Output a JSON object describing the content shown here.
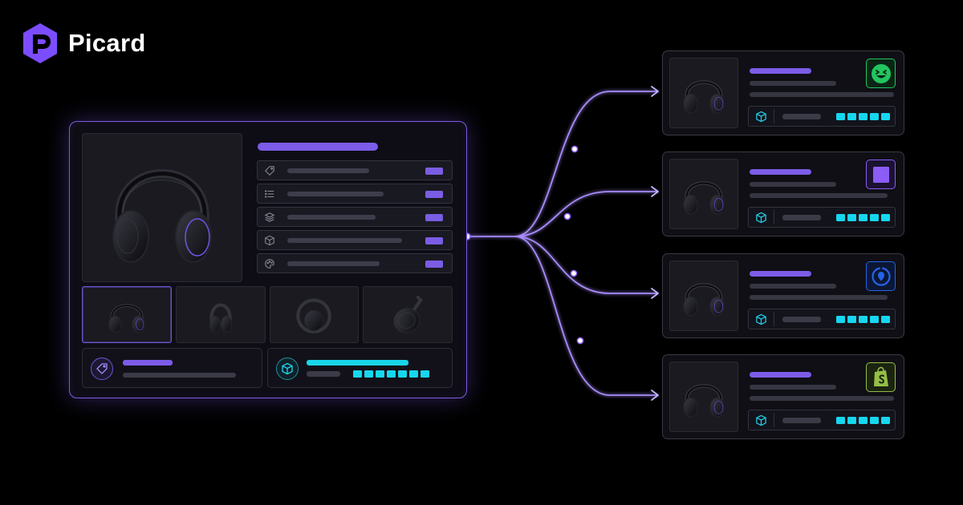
{
  "brand": {
    "name": "Picard",
    "colors": {
      "logo": "#7c4dff",
      "text": "#ffffff"
    },
    "icon": "picard-logo-icon"
  },
  "palette": {
    "background": "#000000",
    "accent_purple": "#7c5ce8",
    "accent_cyan": "#16d7ef",
    "connector": "#a78bfa"
  },
  "main_product": {
    "image_icon": "headphones-image",
    "thumbnails": [
      {
        "icon": "headphones-front-image",
        "selected": true
      },
      {
        "icon": "headphones-side-image",
        "selected": false
      },
      {
        "icon": "headphones-flat-image",
        "selected": false
      },
      {
        "icon": "headphones-earcup-image",
        "selected": false
      }
    ],
    "attributes": [
      {
        "icon": "tag-icon"
      },
      {
        "icon": "list-icon"
      },
      {
        "icon": "layers-icon"
      },
      {
        "icon": "box-icon"
      },
      {
        "icon": "palette-icon"
      }
    ],
    "price_tile_icon": "price-tag-icon",
    "inventory_tile_icon": "package-icon",
    "inventory_level": 7
  },
  "channels": [
    {
      "icon": "smiley-channel-logo",
      "color": "#22c55e",
      "level": 5
    },
    {
      "icon": "square-channel-logo",
      "color": "#8b5cf6",
      "level": 5
    },
    {
      "icon": "target-channel-logo",
      "color": "#2563eb",
      "level": 5
    },
    {
      "icon": "shopify-channel-logo",
      "color": "#95bf47",
      "level": 5
    }
  ]
}
